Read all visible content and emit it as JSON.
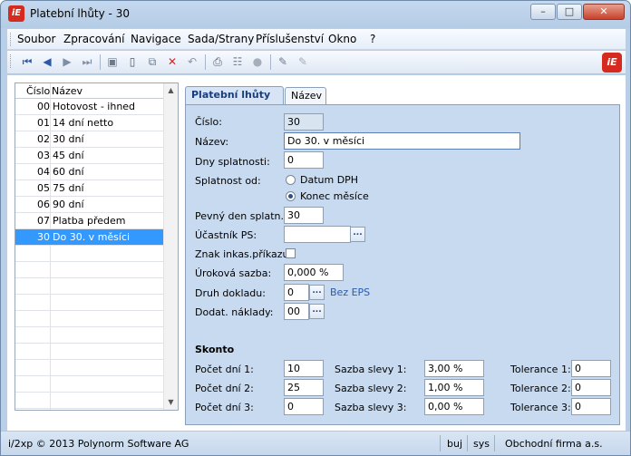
{
  "window": {
    "title": "Platební lhůty - 30",
    "logo_text": "iE"
  },
  "menu": [
    "Soubor",
    "Zpracování",
    "Navigace",
    "Sada/Strany",
    "Příslušenství",
    "Okno",
    "?"
  ],
  "toolbar": {
    "icons": [
      "first-record-icon",
      "prev-record-icon",
      "next-record-icon",
      "last-record-icon",
      "save-icon",
      "new-icon",
      "copy-icon",
      "delete-icon",
      "undo-icon",
      "print-icon",
      "tree-icon",
      "disabled-circle-icon",
      "edit-pen-icon",
      "edit-pen-disabled-icon"
    ]
  },
  "list": {
    "headers": {
      "cislo": "Číslo",
      "nazev": "Název"
    },
    "rows": [
      {
        "cislo": "00",
        "nazev": "Hotovost - ihned"
      },
      {
        "cislo": "01",
        "nazev": "14 dní netto"
      },
      {
        "cislo": "02",
        "nazev": "30 dní"
      },
      {
        "cislo": "03",
        "nazev": "45 dní"
      },
      {
        "cislo": "04",
        "nazev": "60 dní"
      },
      {
        "cislo": "05",
        "nazev": "75 dní"
      },
      {
        "cislo": "06",
        "nazev": "90 dní"
      },
      {
        "cislo": "07",
        "nazev": "Platba předem"
      },
      {
        "cislo": "30",
        "nazev": "Do 30. v měsíci"
      }
    ],
    "selected_index": 8
  },
  "tabs": [
    "Platební lhůty",
    "Název"
  ],
  "form": {
    "cislo": {
      "label": "Číslo:",
      "value": "30"
    },
    "nazev": {
      "label": "Název:",
      "value": "Do 30. v měsíci"
    },
    "dny_splatnosti": {
      "label": "Dny splatnosti:",
      "value": "0"
    },
    "splatnost_od": {
      "label": "Splatnost od:",
      "opt1": "Datum DPH",
      "opt2": "Konec měsíce",
      "selected": "Konec měsíce"
    },
    "pevny_den": {
      "label": "Pevný den splatn.:",
      "value": "30"
    },
    "ucastnik_ps": {
      "label": "Účastník PS:",
      "value": ""
    },
    "znak_inkas": {
      "label": "Znak inkas.příkazu:",
      "checked": false
    },
    "urokova_sazba": {
      "label": "Úroková sazba:",
      "value": "0,000 %"
    },
    "druh_dokladu": {
      "label": "Druh dokladu:",
      "value": "0",
      "hint": "Bez EPS"
    },
    "dodat_naklady": {
      "label": "Dodat. náklady:",
      "value": "00"
    },
    "skonto": {
      "title": "Skonto",
      "pocet_dni_1": {
        "label": "Počet dní 1:",
        "value": "10"
      },
      "pocet_dni_2": {
        "label": "Počet dní 2:",
        "value": "25"
      },
      "pocet_dni_3": {
        "label": "Počet dní 3:",
        "value": "0"
      },
      "sazba_slevy_1": {
        "label": "Sazba slevy 1:",
        "value": "3,00 %"
      },
      "sazba_slevy_2": {
        "label": "Sazba slevy 2:",
        "value": "1,00 %"
      },
      "sazba_slevy_3": {
        "label": "Sazba slevy 3:",
        "value": "0,00 %"
      },
      "tolerance_1": {
        "label": "Tolerance 1:",
        "value": "0"
      },
      "tolerance_2": {
        "label": "Tolerance 2:",
        "value": "0"
      },
      "tolerance_3": {
        "label": "Tolerance 3:",
        "value": "0"
      }
    }
  },
  "status": {
    "copyright": "i/2xp © 2013 Polynorm Software AG",
    "user": "buj",
    "system": "sys",
    "company": "Obchodní firma a.s."
  }
}
